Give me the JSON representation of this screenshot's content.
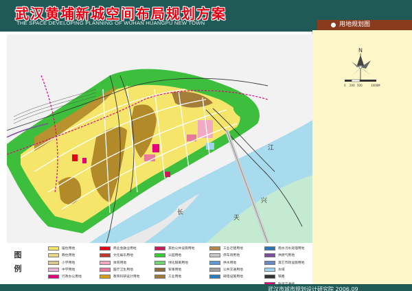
{
  "header": {
    "title": "武汉黄埔新城空间布局规划方案",
    "subtitle": "THE SPACE DEVELOPING PLANNING OF WUHAN HUANGPU NEW TOWN"
  },
  "tab": {
    "label": "用地规划图"
  },
  "compass": {
    "north_label": "N"
  },
  "scale_bar": {
    "labels": [
      "0",
      "200",
      "500",
      "1000M"
    ]
  },
  "map_labels": {
    "river_char_1": "长",
    "river_char_2": "江",
    "river_char_3": "天",
    "river_char_4": "兴"
  },
  "legend": {
    "title": "图例",
    "items": [
      {
        "label": "居住用地",
        "color": "#f5e66b"
      },
      {
        "label": "教住用地",
        "color": "#e8d98a"
      },
      {
        "label": "小学用地",
        "color": "#d9c890"
      },
      {
        "label": "中学用地",
        "color": "#e6b8d6"
      },
      {
        "label": "行政办公用地",
        "color": "#e5007e"
      },
      {
        "label": "商业金融业用地",
        "color": "#e60012"
      },
      {
        "label": "文化娱乐用地",
        "color": "#c0392b"
      },
      {
        "label": "体育用地",
        "color": "#f2a9c2"
      },
      {
        "label": "医疗卫生用地",
        "color": "#e87a9a"
      },
      {
        "label": "教育科研设计用地",
        "color": "#d4a017"
      },
      {
        "label": "其他公共设施用地",
        "color": "#c81c5b"
      },
      {
        "label": "公园用地",
        "color": "#33cc33"
      },
      {
        "label": "绿化隔离用地",
        "color": "#6fd66f"
      },
      {
        "label": "军事用地",
        "color": "#8c6d3f"
      },
      {
        "label": "工业用地",
        "color": "#9c7b3c"
      },
      {
        "label": "工业迁建用地",
        "color": "#b5894d"
      },
      {
        "label": "停车场用地",
        "color": "#c9c9c9"
      },
      {
        "label": "供水用地",
        "color": "#5b9bd5"
      },
      {
        "label": "公共交通用地",
        "color": "#a0a0a0"
      },
      {
        "label": "邮电设施用地",
        "color": "#2b7fc1"
      },
      {
        "label": "雨水污水处理用地",
        "color": "#2e75b6"
      },
      {
        "label": "供燃气用地",
        "color": "#7a4fa0"
      },
      {
        "label": "其它市政设施用地",
        "color": "#6a86c5"
      },
      {
        "label": "水域",
        "color": "#9fd3ea"
      },
      {
        "label": "铁路",
        "color": "#333333"
      },
      {
        "label": "轨道交通线",
        "color": "#e5007e"
      }
    ]
  },
  "footer": {
    "text": "武汉市城市规划设计研究院  2006.09"
  }
}
